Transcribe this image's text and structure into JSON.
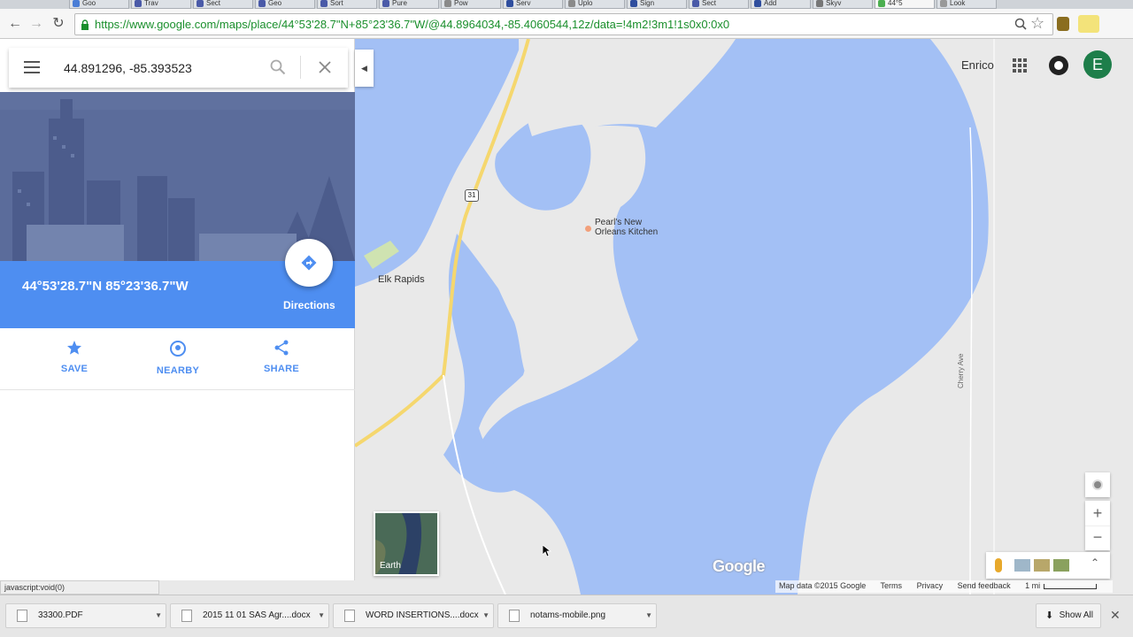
{
  "browser": {
    "tabs": [
      {
        "label": "Goo",
        "color": "#4a7dd6"
      },
      {
        "label": "Trav",
        "color": "#4a5aa8"
      },
      {
        "label": "Sect",
        "color": "#4a5aa8"
      },
      {
        "label": "Geo",
        "color": "#4a5aa8"
      },
      {
        "label": "Sort",
        "color": "#4a5aa8"
      },
      {
        "label": "Pure",
        "color": "#4a5aa8"
      },
      {
        "label": "Pow",
        "color": "#8a8a8a"
      },
      {
        "label": "Serv",
        "color": "#2f4e9e"
      },
      {
        "label": "Uplo",
        "color": "#8a8a8a"
      },
      {
        "label": "Sign",
        "color": "#2f4e9e"
      },
      {
        "label": "Sect",
        "color": "#4a5aa8"
      },
      {
        "label": "Add",
        "color": "#2f4e9e"
      },
      {
        "label": "Skyv",
        "color": "#777"
      },
      {
        "label": "44°5",
        "color": "#4caf50"
      },
      {
        "label": "Look",
        "color": "#999"
      }
    ],
    "url": "https://www.google.com/maps/place/44°53'28.7\"N+85°23'36.7\"W/@44.8964034,-85.4060544,12z/data=!4m2!3m1!1s0x0:0x0",
    "status_text": "javascript:void(0)"
  },
  "sidebar": {
    "search_value": "44.891296, -85.393523",
    "coordinates": "44°53'28.7\"N 85°23'36.7\"W",
    "directions_label": "Directions",
    "actions": [
      {
        "label": "SAVE",
        "icon": "star-icon"
      },
      {
        "label": "NEARBY",
        "icon": "nearby-icon"
      },
      {
        "label": "SHARE",
        "icon": "share-icon"
      }
    ]
  },
  "map": {
    "user_name": "Enrico",
    "avatar_letter": "E",
    "labels": {
      "restaurant": "Pearl's New Orleans Kitchen",
      "restaurant_line1": "Pearl's New",
      "restaurant_line2": "Orleans Kitchen",
      "town": "Elk Rapids",
      "road": "Cherry Ave",
      "highway": "31"
    },
    "earth_label": "Earth",
    "logo": "Google",
    "footer": {
      "map_data": "Map data ©2015 Google",
      "terms": "Terms",
      "privacy": "Privacy",
      "feedback": "Send feedback",
      "scale": "1 mi"
    },
    "colors": {
      "water": "#a3c0f5",
      "land": "#e9e9e9",
      "road": "#f5d76e"
    }
  },
  "downloads": {
    "items": [
      {
        "name": "33300.PDF"
      },
      {
        "name": "2015 11 01 SAS Agr....docx"
      },
      {
        "name": "WORD INSERTIONS....docx"
      },
      {
        "name": "notams-mobile.png"
      }
    ],
    "show_all": "Show All"
  }
}
